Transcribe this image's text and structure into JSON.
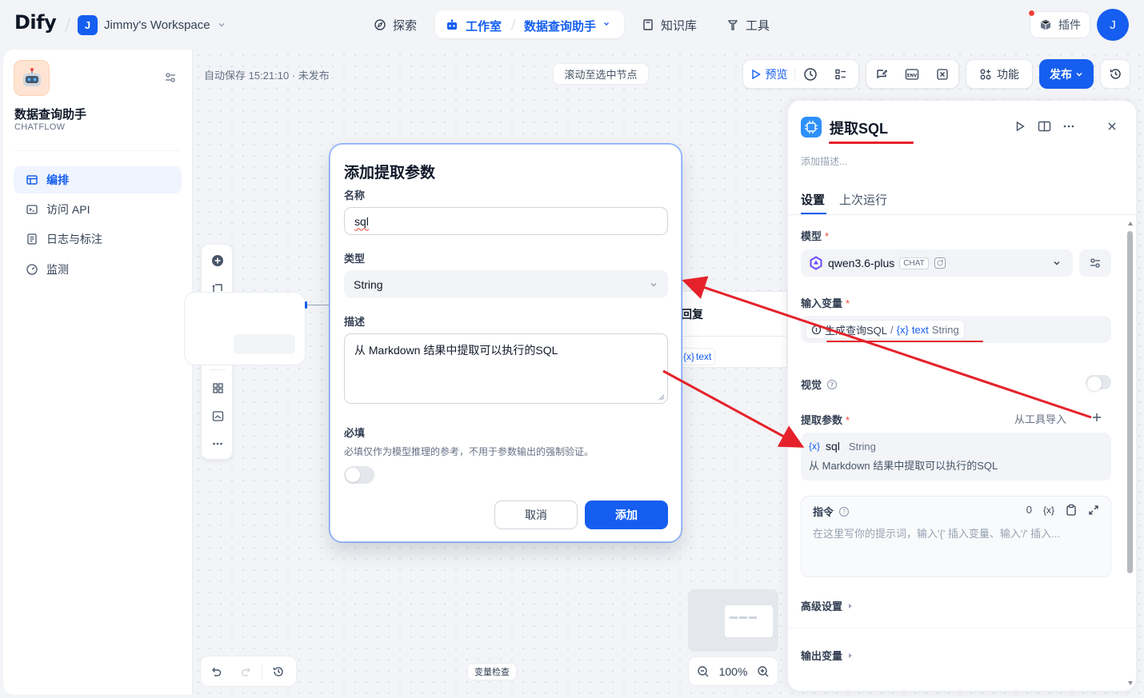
{
  "header": {
    "logo": "Dify",
    "workspace": {
      "avatar": "J",
      "name": "Jimmy's Workspace"
    },
    "nav": {
      "explore": "探索",
      "studio": "工作室",
      "app_crumb": "数据查询助手",
      "knowledge": "知识库",
      "tools": "工具"
    },
    "plugins": "插件",
    "user_avatar": "J"
  },
  "sidebar": {
    "app_name": "数据查询助手",
    "app_type": "CHATFLOW",
    "menu": [
      "编排",
      "访问 API",
      "日志与标注",
      "监测"
    ]
  },
  "canvas": {
    "autosave": "自动保存 15:21:10 · 未发布",
    "scroll_to_node": "滚动至选中节点",
    "preview": "预览",
    "features": "功能",
    "publish": "发布",
    "var_inspect": "变量检查",
    "zoom": "100%",
    "node_right_title": "回复",
    "node_right_var": "text"
  },
  "modal": {
    "title": "添加提取参数",
    "name_label": "名称",
    "name_value": "sql",
    "type_label": "类型",
    "type_value": "String",
    "desc_label": "描述",
    "desc_value": "从 Markdown 结果中提取可以执行的SQL",
    "required_label": "必填",
    "required_hint": "必填仅作为模型推理的参考，不用于参数输出的强制验证。",
    "cancel": "取消",
    "add": "添加"
  },
  "panel": {
    "title": "提取SQL",
    "desc_placeholder": "添加描述...",
    "tabs": [
      "设置",
      "上次运行"
    ],
    "model_label": "模型",
    "model_name": "qwen3.6-plus",
    "model_badge": "CHAT",
    "input_var_label": "输入变量",
    "input_var": {
      "node": "生成查询SQL",
      "var": "text",
      "type": "String"
    },
    "vision_label": "视觉",
    "params_label": "提取参数",
    "import_from_tool": "从工具导入",
    "param": {
      "name": "sql",
      "type": "String",
      "desc": "从 Markdown 结果中提取可以执行的SQL"
    },
    "instruction_label": "指令",
    "instruction_count": "0",
    "instruction_placeholder": "在这里写你的提示词，输入'{' 插入变量、输入'/' 插入...",
    "advanced": "高级设置",
    "output_vars": "输出变量"
  },
  "colors": {
    "primary": "#155eef",
    "annotation": "#e5222b"
  }
}
